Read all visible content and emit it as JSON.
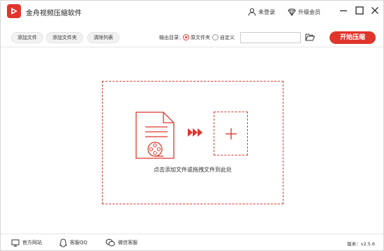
{
  "app": {
    "title": "金舟视频压缩软件"
  },
  "titlebar": {
    "login_label": "未登录",
    "vip_label": "升级会员"
  },
  "toolbar": {
    "add_file": "添加文件",
    "add_folder": "添加文件夹",
    "clear_list": "清除列表",
    "output_dir_label": "输出目录：",
    "output_options": [
      {
        "label": "原文件夹",
        "selected": true
      },
      {
        "label": "自定义",
        "selected": false
      }
    ],
    "path_value": "",
    "start_label": "开始压缩"
  },
  "main": {
    "hint": "点击添加文件或拖拽文件到此处"
  },
  "footer": {
    "website": "官方网站",
    "qq": "客服QQ",
    "wechat": "微信客服",
    "version": "版本：v2.5.6"
  },
  "colors": {
    "accent": "#e0352b",
    "border": "#d6d6d6"
  },
  "icons": [
    "app-logo-icon",
    "user-icon",
    "vip-diamond-icon",
    "minimize-icon",
    "maximize-icon",
    "close-icon",
    "folder-open-icon",
    "video-file-icon",
    "arrows-right-icon",
    "plus-icon",
    "home-monitor-icon",
    "qq-icon",
    "wechat-icon"
  ]
}
